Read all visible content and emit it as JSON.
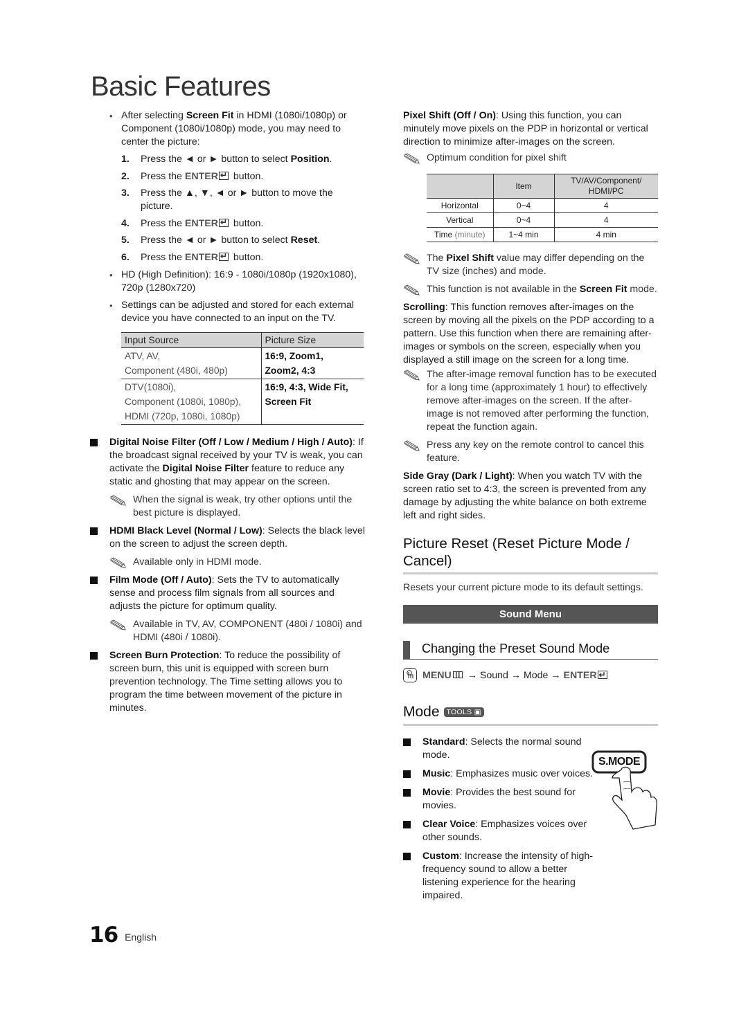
{
  "page": {
    "title": "Basic Features",
    "page_number": "16",
    "language": "English"
  },
  "left": {
    "bullet1": {
      "pre": "After selecting ",
      "bold": "Screen Fit",
      "post": " in HDMI (1080i/1080p) or Component (1080i/1080p) mode, you may need to center the picture:"
    },
    "steps": [
      {
        "num": "1.",
        "pre": "Press the ◄ or ► button to select ",
        "bold": "Position",
        "post": "."
      },
      {
        "num": "2.",
        "pre": "Press the ",
        "key": "ENTER",
        "post": " button."
      },
      {
        "num": "3.",
        "pre": "Press the ▲, ▼, ◄ or ► button to move the picture.",
        "bold": "",
        "post": ""
      },
      {
        "num": "4.",
        "pre": "Press the ",
        "key": "ENTER",
        "post": " button."
      },
      {
        "num": "5.",
        "pre": "Press the ◄ or ► button to select ",
        "bold": "Reset",
        "post": "."
      },
      {
        "num": "6.",
        "pre": "Press the ",
        "key": "ENTER",
        "post": " button."
      }
    ],
    "bullet2": "HD (High Definition): 16:9 - 1080i/1080p (1920x1080), 720p (1280x720)",
    "bullet3": "Settings can be adjusted and stored for each external device you have connected to an input on the TV.",
    "input_table": {
      "headers": [
        "Input Source",
        "Picture Size"
      ],
      "rows": [
        {
          "source_lines": [
            "ATV, AV,",
            "Component (480i, 480p)"
          ],
          "size_lines": [
            "16:9, Zoom1,",
            "Zoom2, 4:3"
          ]
        },
        {
          "source_lines": [
            "DTV(1080i),",
            "Component (1080i, 1080p),",
            "HDMI (720p, 1080i, 1080p)"
          ],
          "size_lines": [
            "16:9, 4:3, Wide Fit,",
            "Screen Fit"
          ]
        }
      ]
    },
    "items": [
      {
        "bold": "Digital Noise Filter (Off / Low / Medium / High / Auto)",
        "text_a": ": If the broadcast signal received by your TV is weak, you can activate the ",
        "bold2": "Digital Noise Filter",
        "text_b": " feature to reduce any static and ghosting that may appear on the screen.",
        "note": "When the signal is weak, try other options until the best picture is displayed."
      },
      {
        "bold": "HDMI Black Level (Normal / Low)",
        "text_a": ": Selects the black level on the screen to adjust the screen depth.",
        "note": "Available only in HDMI mode."
      },
      {
        "bold": "Film Mode (Off / Auto)",
        "text_a": ": Sets the TV to automatically sense and process film signals from all sources and adjusts the picture for optimum quality.",
        "note": "Available in TV, AV, COMPONENT (480i / 1080i) and HDMI (480i / 1080i)."
      },
      {
        "bold": "Screen Burn Protection",
        "text_a": ": To reduce the possibility of screen burn, this unit is equipped with screen burn prevention technology. The Time setting allows you to program the time between movement of the picture in minutes."
      }
    ]
  },
  "right": {
    "pixel_shift": {
      "bold": "Pixel Shift (Off / On)",
      "text": ": Using this function, you can minutely move pixels on the PDP in horizontal or vertical direction to minimize after-images on the screen.",
      "note": "Optimum condition for pixel shift"
    },
    "pixel_table": {
      "headers": [
        "",
        "Item",
        "TV/AV/Component/ HDMI/PC"
      ],
      "rows": [
        {
          "label": "Horizontal",
          "label_suffix": "",
          "item": "0~4",
          "value": "4"
        },
        {
          "label": "Vertical",
          "label_suffix": "",
          "item": "0~4",
          "value": "4"
        },
        {
          "label": "Time",
          "label_suffix": "(minute)",
          "item": "1~4 min",
          "value": "4 min"
        }
      ]
    },
    "notes_after_table": [
      {
        "pre": "The ",
        "bold": "Pixel Shift",
        "post": " value may differ depending on the TV size (inches) and mode."
      },
      {
        "pre": "This function is not available in the ",
        "bold": "Screen Fit",
        "post": " mode."
      }
    ],
    "scrolling": {
      "bold": "Scrolling",
      "text": ": This function removes after-images on the screen by moving all the pixels on the PDP according to a pattern. Use this function when there are remaining after-images or symbols on the screen, especially when you displayed a still image on the screen for a long time.",
      "notes": [
        "The after-image removal function has to be executed for a long time (approximately 1 hour) to effectively remove after-images on the screen. If the after-image is not removed after performing the function, repeat the function again.",
        "Press any key on the remote control to cancel this feature."
      ]
    },
    "side_gray": {
      "bold": "Side Gray (Dark / Light)",
      "text": ": When you watch TV with the screen ratio set to 4:3, the screen is prevented from any damage by adjusting the white balance on both extreme left and right sides."
    },
    "picture_reset": {
      "heading": "Picture Reset (Reset Picture Mode / Cancel)",
      "desc": "Resets your current picture mode to its default settings."
    },
    "sound_menu_bar": "Sound Menu",
    "preset_heading": "Changing the Preset Sound Mode",
    "menu_path": {
      "menu": "MENU",
      "rest": " → Sound → Mode → ",
      "enter": "ENTER"
    },
    "mode_heading": "Mode",
    "tools_badge": "TOOLS",
    "smode_label": "S.MODE",
    "sound_modes": [
      {
        "bold": "Standard",
        "text": ": Selects the normal sound mode."
      },
      {
        "bold": "Music",
        "text": ": Emphasizes music over voices."
      },
      {
        "bold": "Movie",
        "text": ": Provides the best sound for movies."
      },
      {
        "bold": "Clear Voice",
        "text": ": Emphasizes voices over other sounds."
      },
      {
        "bold": "Custom",
        "text": ": Increase the intensity of high-frequency sound to allow a better listening experience for the hearing impaired."
      }
    ]
  }
}
